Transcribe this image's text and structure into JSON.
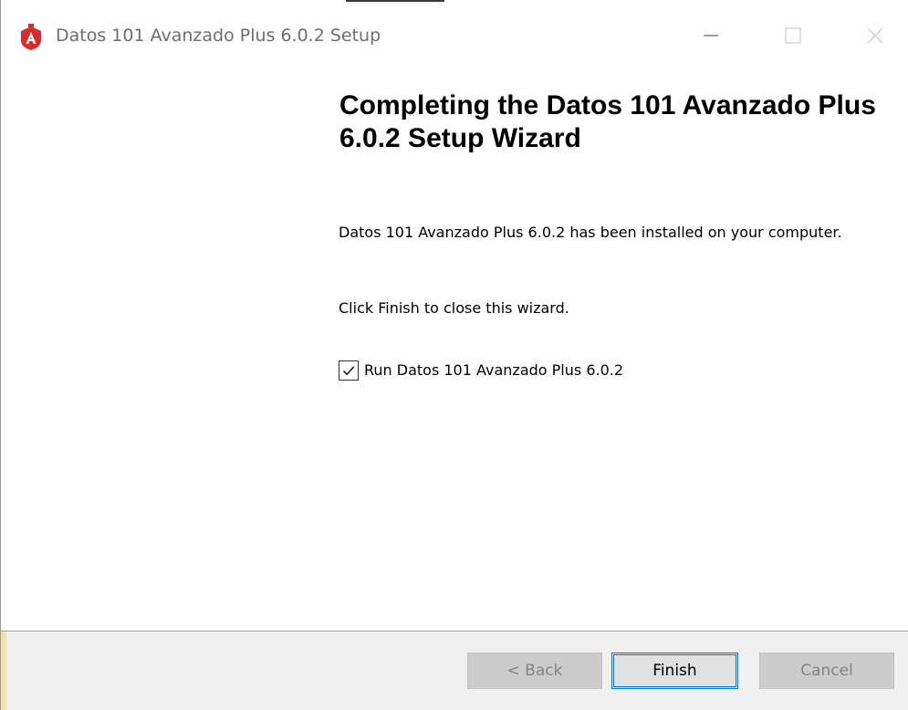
{
  "window": {
    "title": "Datos 101 Avanzado Plus 6.0.2 Setup",
    "accent_color": "#0078d7",
    "icon_color": "#d62c2c"
  },
  "wizard": {
    "heading": "Completing the Datos 101 Avanzado Plus 6.0.2 Setup Wizard",
    "installed_message": "Datos 101 Avanzado Plus 6.0.2 has been installed on your computer.",
    "finish_instruction": "Click Finish to close this wizard.",
    "run_checkbox": {
      "label": "Run Datos 101 Avanzado Plus 6.0.2",
      "checked": true
    }
  },
  "footer": {
    "back_label": "< Back",
    "finish_label": "Finish",
    "cancel_label": "Cancel"
  },
  "icons": {
    "app": "red-shield-a-icon",
    "minimize": "minimize-icon",
    "maximize": "maximize-icon",
    "close": "close-icon",
    "check": "checkmark-icon"
  }
}
